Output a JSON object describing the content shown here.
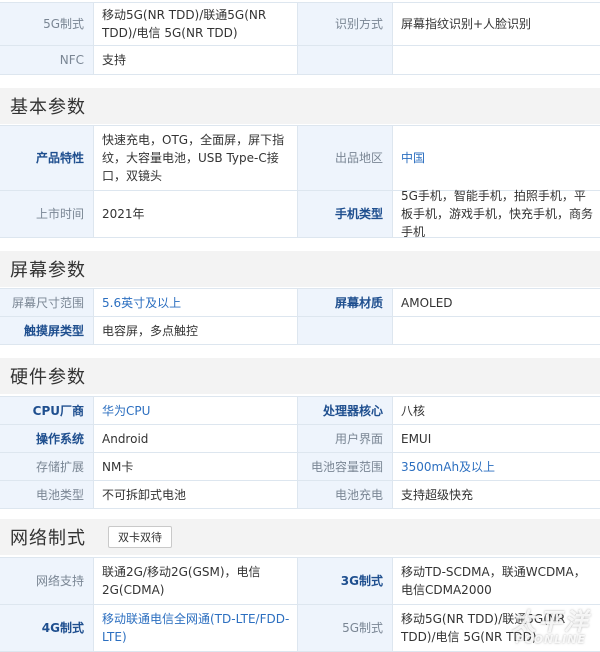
{
  "top": {
    "rows": [
      {
        "l1": "5G制式",
        "v1": "移动5G(NR TDD)/联通5G(NR TDD)/电信 5G(NR TDD)",
        "l2": "识别方式",
        "v2": "屏幕指纹识别+人脸识别"
      },
      {
        "l1": "NFC",
        "v1": "支持",
        "l2": "",
        "v2": ""
      }
    ]
  },
  "basic": {
    "title": "基本参数",
    "rows": [
      {
        "l1": "产品特性",
        "v1": "快速充电，OTG，全面屏，屏下指纹，大容量电池，USB Type-C接口，双镜头",
        "l2": "出品地区",
        "v2": "中国"
      },
      {
        "l1": "上市时间",
        "v1": "2021年",
        "l2": "手机类型",
        "v2": "5G手机，智能手机，拍照手机，平板手机，游戏手机，快充手机，商务手机"
      }
    ]
  },
  "screen": {
    "title": "屏幕参数",
    "rows": [
      {
        "l1": "屏幕尺寸范围",
        "v1": "5.6英寸及以上",
        "l2": "屏幕材质",
        "v2": "AMOLED"
      },
      {
        "l1": "触摸屏类型",
        "v1": "电容屏，多点触控",
        "l2": "",
        "v2": ""
      }
    ]
  },
  "hardware": {
    "title": "硬件参数",
    "rows": [
      {
        "l1": "CPU厂商",
        "v1": "华为CPU",
        "l2": "处理器核心",
        "v2": "八核"
      },
      {
        "l1": "操作系统",
        "v1": "Android",
        "l2": "用户界面",
        "v2": "EMUI"
      },
      {
        "l1": "存储扩展",
        "v1": "NM卡",
        "l2": "电池容量范围",
        "v2": "3500mAh及以上"
      },
      {
        "l1": "电池类型",
        "v1": "不可拆卸式电池",
        "l2": "电池充电",
        "v2": "支持超级快充"
      }
    ]
  },
  "network": {
    "title": "网络制式",
    "button": "双卡双待",
    "rows": [
      {
        "l1": "网络支持",
        "v1": "联通2G/移动2G(GSM)，电信2G(CDMA)",
        "l2": "3G制式",
        "v2": "移动TD-SCDMA，联通WCDMA，电信CDMA2000"
      },
      {
        "l1": "4G制式",
        "v1": "移动联通电信全网通(TD-LTE/FDD-LTE)",
        "l2": "5G制式",
        "v2": "移动5G(NR TDD)/联通5G(NR TDD)/电信 5G(NR TDD)"
      }
    ]
  },
  "watermark": {
    "cn": "太平洋",
    "en": "PCONLINE"
  }
}
